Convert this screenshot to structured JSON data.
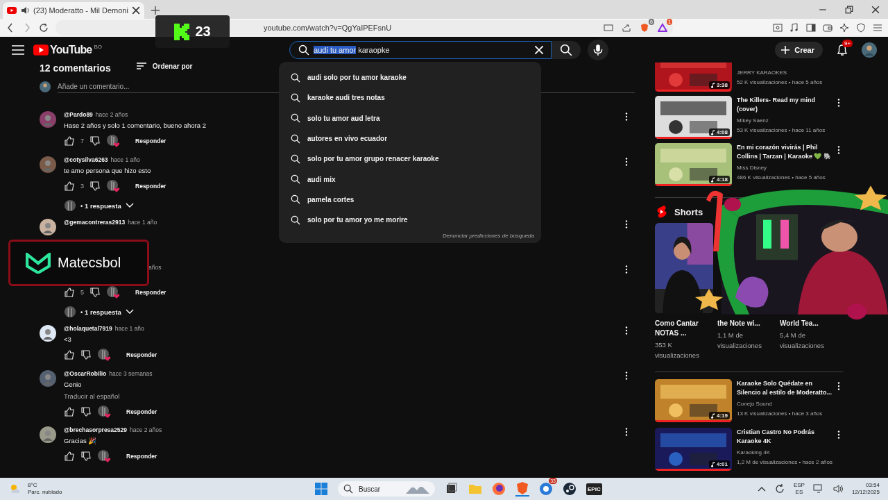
{
  "browser": {
    "tab": {
      "title": "(23) Moderatto - Mil Demoni",
      "audio": true
    },
    "url": "youtube.com/watch?v=QgYaIPEFsnU",
    "extension_badges": [
      "6",
      "1"
    ]
  },
  "stream_overlays": {
    "viewers": "23",
    "channel": "Matecsbol"
  },
  "masthead": {
    "logo": "YouTube",
    "country": "BO",
    "search": {
      "selected_text": "audi tu amor",
      "rest_text": "karaopke"
    },
    "create": "Crear",
    "notifications": "9+"
  },
  "suggestions": [
    "audi solo por tu amor karaoke",
    "karaoke audi tres notas",
    "solo tu amor aud letra",
    "autores en vivo ecuador",
    "solo por tu amor grupo renacer karaoke",
    "audi mix",
    "pamela cortes",
    "solo por tu amor yo me morire"
  ],
  "suggestions_footer": "Denunciar predicciones de búsqueda",
  "comments_header": {
    "count": "12 comentarios",
    "sort": "Ordenar por",
    "placeholder": "Añade un comentario..."
  },
  "comments": [
    {
      "author": "@Pardo89",
      "time": "hace 2 años",
      "text": "Hase 2 años y solo 1 comentario, bueno ahora 2",
      "likes": "7",
      "reply": "Responder"
    },
    {
      "author": "@cotysilva6263",
      "time": "hace 1 año",
      "text": "te amo persona que hizo esto",
      "likes": "3",
      "reply": "Responder",
      "replies": "• 1 respuesta"
    },
    {
      "author": "@gemacontreras2913",
      "time": "hace 1 año"
    },
    {
      "time": "años",
      "likes": "5",
      "reply": "Responder",
      "replies": "• 1 respuesta"
    },
    {
      "author": "@holaquetal7919",
      "time": "hace 1 año",
      "text": "<3",
      "reply": "Responder"
    },
    {
      "author": "@OscarRobilio",
      "time": "hace 3 semanas",
      "text": "Genio",
      "translate": "Traducir al español",
      "reply": "Responder"
    },
    {
      "author": "@brechasorpresa2529",
      "time": "hace 2 años",
      "text": "Gracias 🎉",
      "reply": "Responder"
    }
  ],
  "related": [
    {
      "channel": "JERRY KARAOKES",
      "meta": "52 K visualizaciones • hace 5 años",
      "duration": "3:38"
    },
    {
      "title": "The Killers- Read my mind (cover)",
      "channel": "Mikey Saenz",
      "meta": "53 K visualizaciones • hace 11 años",
      "duration": "4:08"
    },
    {
      "title": "En mi corazón vivirás | Phil Collins | Tarzan | Karaoke 💚 🐘",
      "channel": "Miss Disney",
      "meta": "486 K visualizaciones • hace 5 años",
      "duration": "4:18"
    }
  ],
  "shorts": {
    "title": "Shorts",
    "items": [
      {
        "title": "Como Cantar NOTAS ...",
        "views": "353 K visualizaciones",
        "kind": "picture"
      },
      {
        "title": "the Note wi...",
        "views": "1,1 M de visualizaciones"
      },
      {
        "title": "World Tea...",
        "views": "5,4 M de visualizaciones"
      }
    ]
  },
  "related_more": [
    {
      "title": "Karaoke Solo Quédate en Silencio al estilo de Moderatto...",
      "channel": "Conejo Sound",
      "meta": "13 K visualizaciones • hace 3 años",
      "duration": "4:19"
    },
    {
      "title": "Cristian Castro  No Podrás Karaoke 4K",
      "channel": "Karaoking 4K",
      "meta": "1,2 M de visualizaciones • hace 2 años",
      "duration": "4:01"
    }
  ],
  "taskbar": {
    "temperature": "8°C",
    "weather": "Parc. nublado",
    "search": "Buscar",
    "app_badge": "33",
    "epic": "EPIC",
    "language": "ESP",
    "layout": "ES",
    "time": "03:54",
    "date": "12/12/2025"
  }
}
